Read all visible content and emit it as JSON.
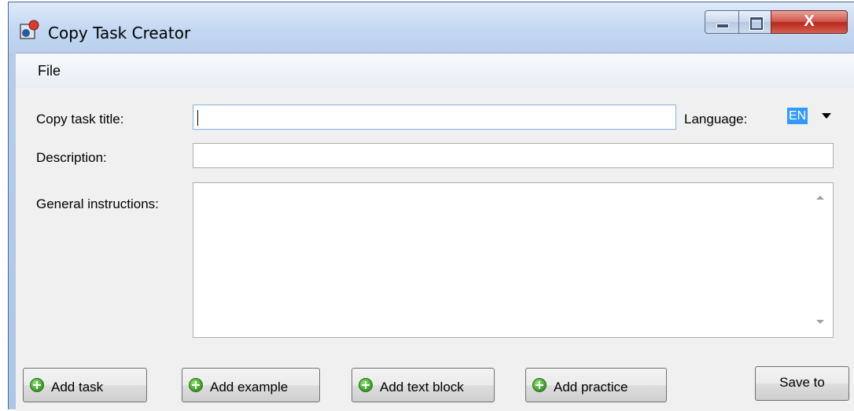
{
  "window": {
    "title": "Copy Task Creator",
    "icon": "app-icon",
    "controls": [
      "minimize",
      "maximize",
      "close"
    ],
    "close_glyph": "X"
  },
  "menu": {
    "file_label": "File"
  },
  "form": {
    "title_label": "Copy task title:",
    "title_value": "",
    "language_label": "Language:",
    "language_value": "EN",
    "description_label": "Description:",
    "description_value": "",
    "instructions_label": "General instructions:",
    "instructions_value": ""
  },
  "buttons": {
    "add_task": "Add task",
    "add_example": "Add example",
    "add_text_block": "Add text block",
    "add_practice": "Add practice",
    "save_to": "Save to"
  },
  "colors": {
    "selection": "#3399ff",
    "add_icon": "#3fa52a",
    "close_button": "#c8392c"
  }
}
